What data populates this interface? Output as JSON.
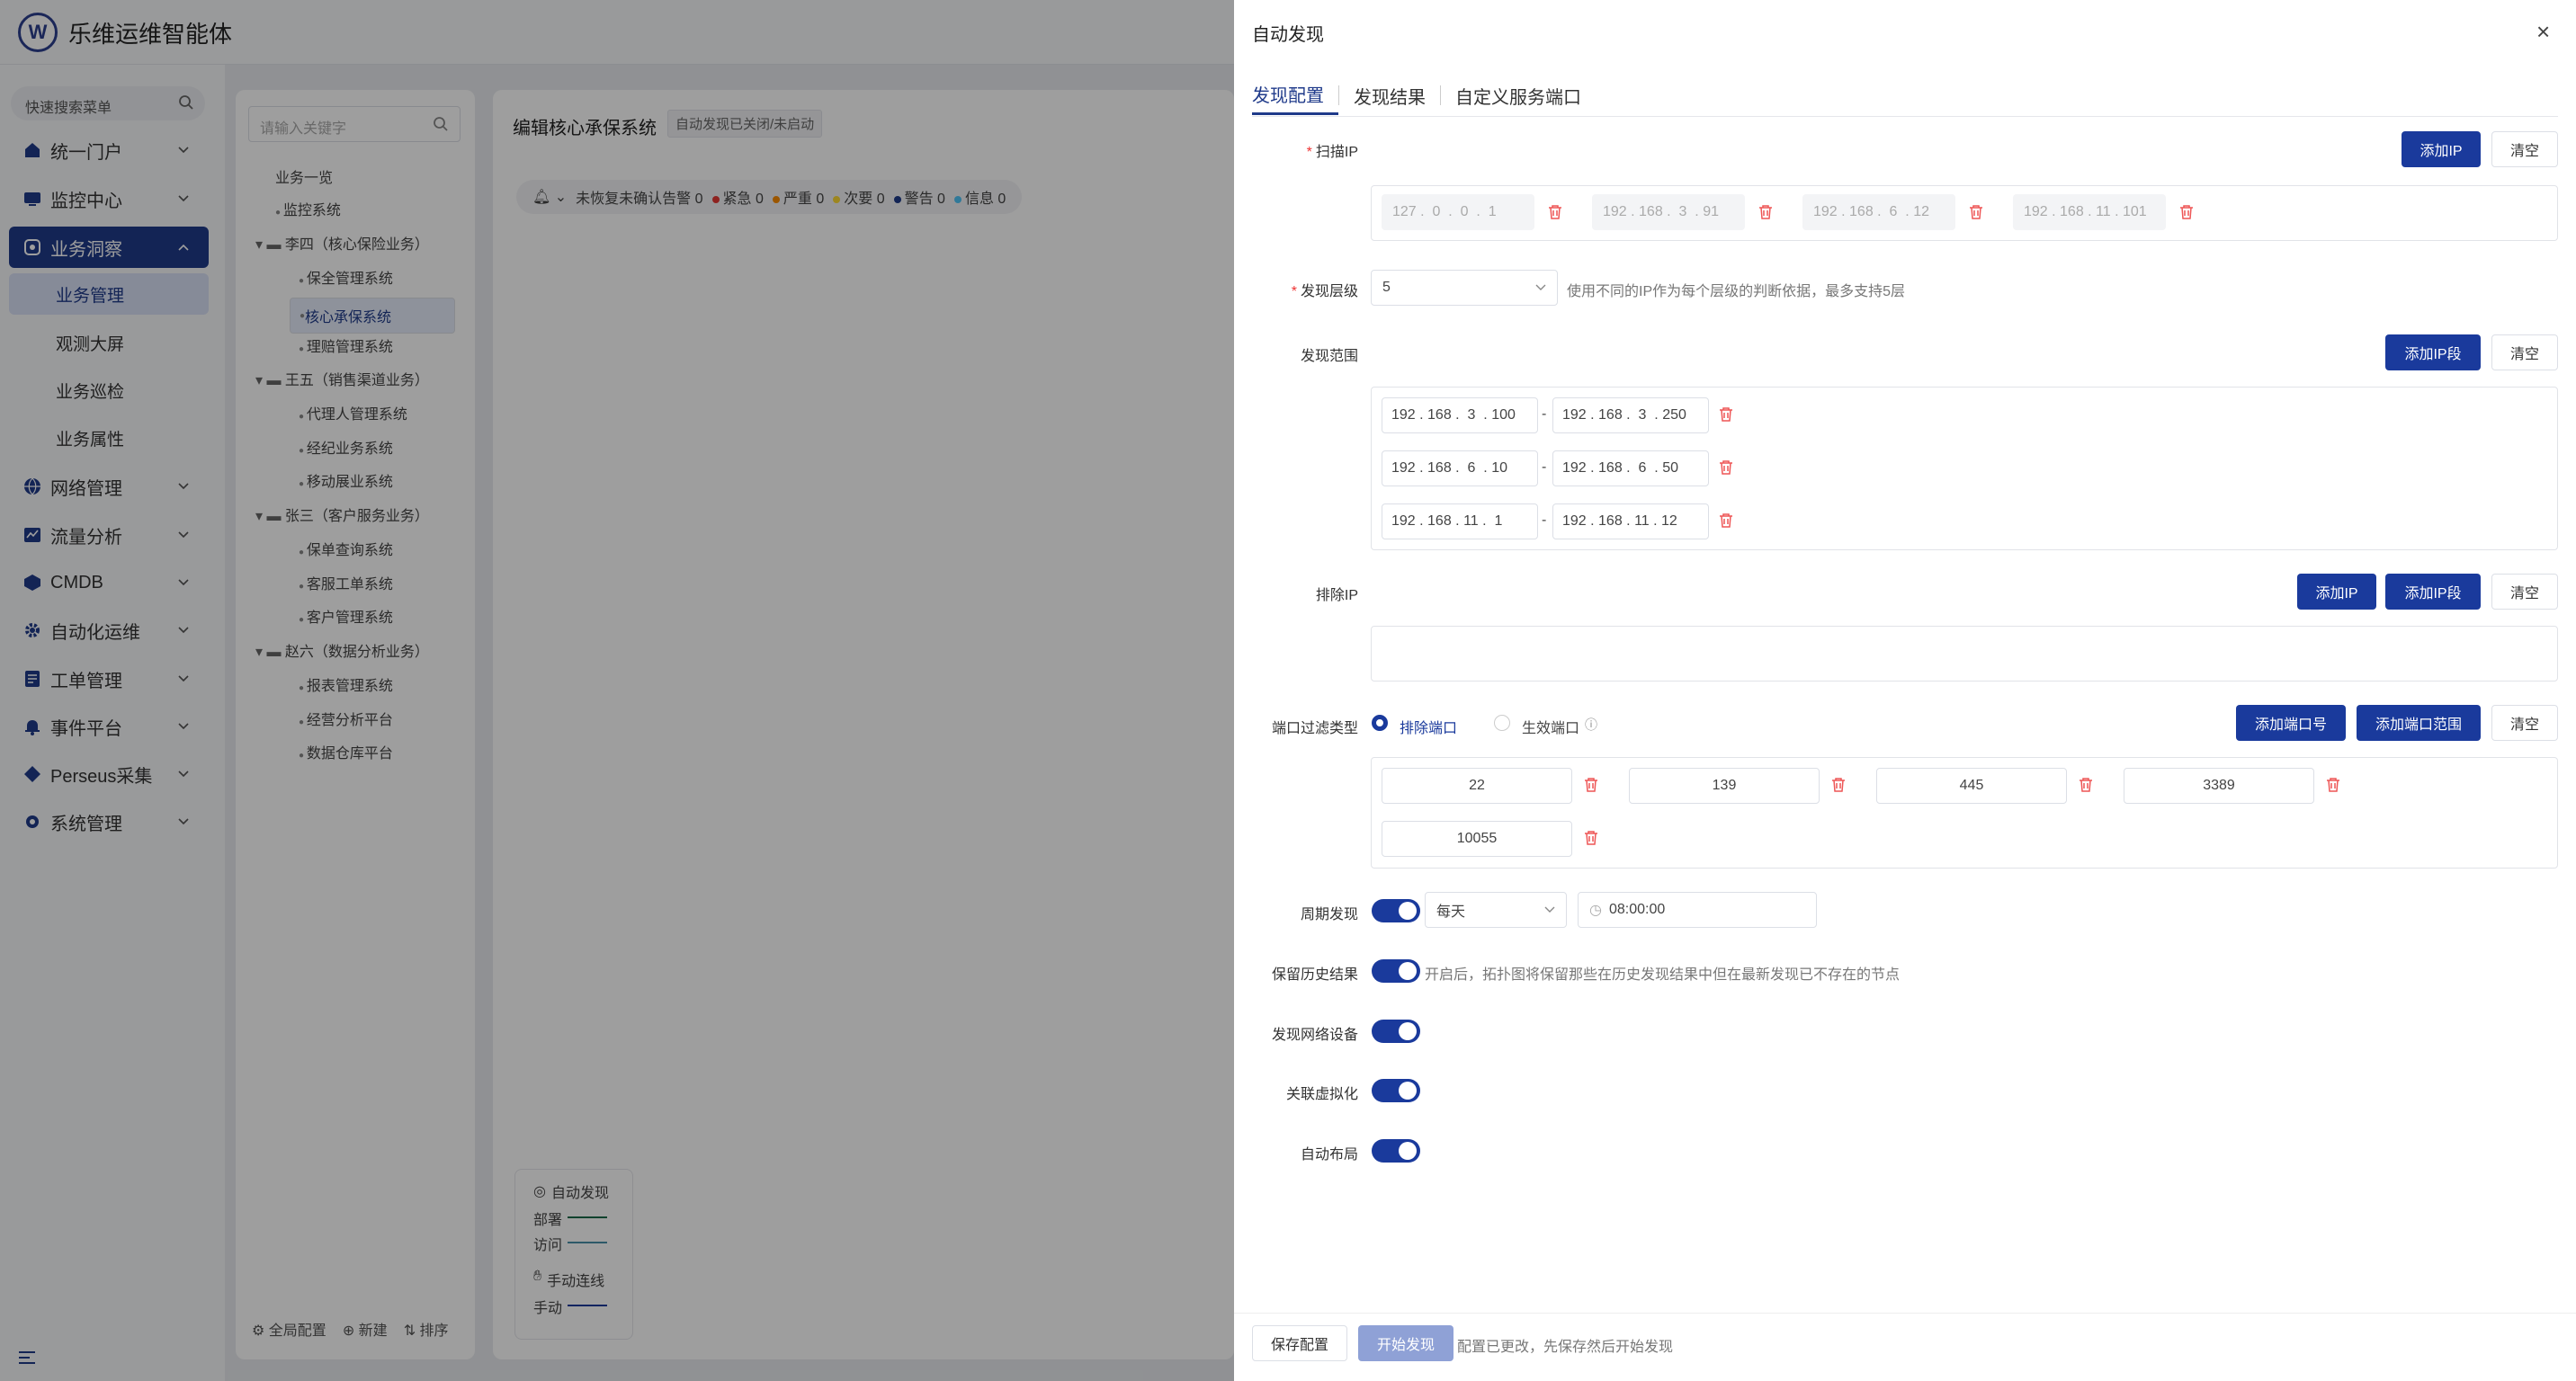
{
  "app": {
    "title": "乐维运维智能体",
    "logo_glyph": "W"
  },
  "sidebar": {
    "search_placeholder": "快速搜索菜单",
    "items": [
      {
        "label": "统一门户",
        "icon": "home-icon"
      },
      {
        "label": "监控中心",
        "icon": "monitor-icon"
      },
      {
        "label": "业务洞察",
        "icon": "insight-icon",
        "active": true
      },
      {
        "label": "网络管理",
        "icon": "globe-icon"
      },
      {
        "label": "流量分析",
        "icon": "traffic-icon"
      },
      {
        "label": "CMDB",
        "icon": "cube-icon"
      },
      {
        "label": "自动化运维",
        "icon": "gear-icon"
      },
      {
        "label": "工单管理",
        "icon": "ticket-icon"
      },
      {
        "label": "事件平台",
        "icon": "bell-icon"
      },
      {
        "label": "Perseus采集",
        "icon": "diamond-icon"
      },
      {
        "label": "系统管理",
        "icon": "settings-icon"
      }
    ],
    "subitems": [
      {
        "label": "业务管理",
        "active": true
      },
      {
        "label": "观测大屏"
      },
      {
        "label": "业务巡检"
      },
      {
        "label": "业务属性"
      }
    ]
  },
  "tree": {
    "search_placeholder": "请输入关键字",
    "root": "业务一览",
    "nodes": [
      {
        "label": "监控系统",
        "level": 1
      },
      {
        "label": "李四（核心保险业务）",
        "level": 0,
        "folder": true
      },
      {
        "label": "保全管理系统",
        "level": 2
      },
      {
        "label": "核心承保系统",
        "level": 2,
        "selected": true
      },
      {
        "label": "理赔管理系统",
        "level": 2
      },
      {
        "label": "王五（销售渠道业务）",
        "level": 0,
        "folder": true
      },
      {
        "label": "代理人管理系统",
        "level": 2
      },
      {
        "label": "经纪业务系统",
        "level": 2
      },
      {
        "label": "移动展业系统",
        "level": 2
      },
      {
        "label": "张三（客户服务业务）",
        "level": 0,
        "folder": true
      },
      {
        "label": "保单查询系统",
        "level": 2
      },
      {
        "label": "客服工单系统",
        "level": 2
      },
      {
        "label": "客户管理系统",
        "level": 2
      },
      {
        "label": "赵六（数据分析业务）",
        "level": 0,
        "folder": true
      },
      {
        "label": "报表管理系统",
        "level": 2
      },
      {
        "label": "经营分析平台",
        "level": 2
      },
      {
        "label": "数据仓库平台",
        "level": 2
      }
    ],
    "footer": {
      "config": "全局配置",
      "new": "新建",
      "sort": "排序"
    }
  },
  "main": {
    "title": "编辑核心承保系统",
    "tag": "自动发现已关闭/未启动",
    "alert": {
      "label": "未恢复未确认告警 0",
      "levels": [
        {
          "label": "紧急 0",
          "color": "#e53935"
        },
        {
          "label": "严重 0",
          "color": "#fb8c00"
        },
        {
          "label": "次要 0",
          "color": "#fdd835"
        },
        {
          "label": "警告 0",
          "color": "#1e3a8a"
        },
        {
          "label": "信息 0",
          "color": "#4fc3f7"
        }
      ]
    },
    "legend": {
      "title": "自动发现",
      "deploy": "部署",
      "visit": "访问",
      "manual_title": "手动连线",
      "manual": "手动"
    }
  },
  "drawer": {
    "title": "自动发现",
    "close": "×",
    "tabs": [
      "发现配置",
      "发现结果",
      "自定义服务端口"
    ],
    "scan_ip": {
      "label": "扫描IP",
      "add": "添加IP",
      "clear": "清空",
      "ips": [
        "127 .  0  .  0  .  1",
        "192 . 168 .  3  . 91",
        "192 . 168 .  6  . 12",
        "192 . 168 . 11 . 101"
      ]
    },
    "level": {
      "label": "发现层级",
      "value": "5",
      "hint": "使用不同的IP作为每个层级的判断依据，最多支持5层"
    },
    "range": {
      "label": "发现范围",
      "add": "添加IP段",
      "clear": "清空",
      "rows": [
        {
          "from": "192 . 168 .  3  . 100",
          "to": "192 . 168 .  3  . 250"
        },
        {
          "from": "192 . 168 .  6  . 10",
          "to": "192 . 168 .  6  . 50"
        },
        {
          "from": "192 . 168 . 11 .  1",
          "to": "192 . 168 . 11 . 12"
        }
      ],
      "dash": "-"
    },
    "exclude": {
      "label": "排除IP",
      "add_ip": "添加IP",
      "add_range": "添加IP段",
      "clear": "清空"
    },
    "port_filter": {
      "label": "端口过滤类型",
      "opt_exclude": "排除端口",
      "opt_effective": "生效端口",
      "add_port": "添加端口号",
      "add_range": "添加端口范围",
      "clear": "清空",
      "ports": [
        "22",
        "139",
        "445",
        "3389",
        "10055"
      ]
    },
    "period": {
      "label": "周期发现",
      "freq": "每天",
      "time": "08:00:00"
    },
    "history": {
      "label": "保留历史结果",
      "hint": "开启后，拓扑图将保留那些在历史发现结果中但在最新发现已不存在的节点"
    },
    "netdev": {
      "label": "发现网络设备"
    },
    "virt": {
      "label": "关联虚拟化"
    },
    "layout": {
      "label": "自动布局"
    },
    "footer": {
      "save": "保存配置",
      "start": "开始发现",
      "hint": "配置已更改，先保存然后开始发现"
    }
  }
}
